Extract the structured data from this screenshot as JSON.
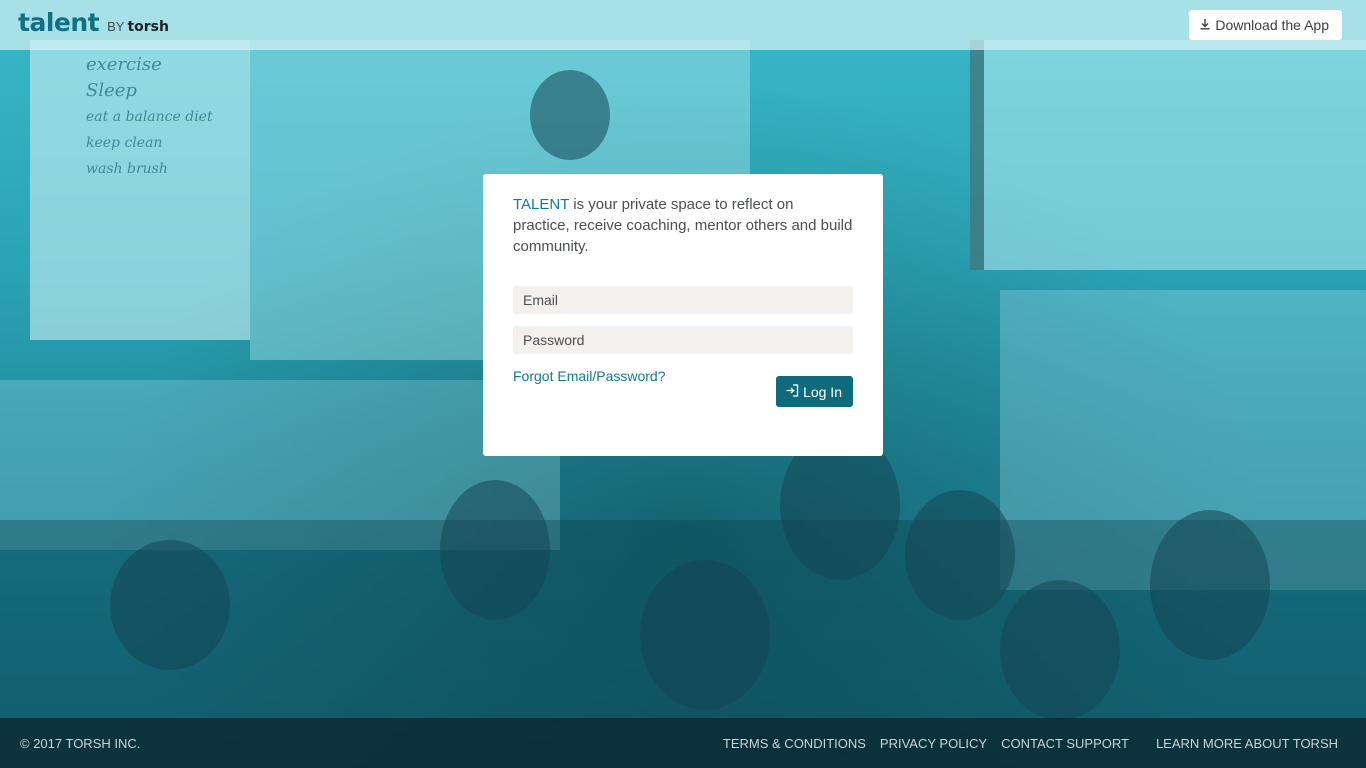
{
  "header": {
    "logo_main": "talent",
    "logo_by": "BY",
    "logo_company": "torsh",
    "download_label": "Download the App"
  },
  "login": {
    "intro_brand": "TALENT",
    "intro_text": " is your private space to reflect on practice, receive coaching, mentor others and build community.",
    "email_placeholder": "Email",
    "password_placeholder": "Password",
    "forgot_label": "Forgot Email/Password?",
    "login_label": "Log In"
  },
  "footer": {
    "copyright": "© 2017 TORSH INC.",
    "links": [
      "TERMS & CONDITIONS",
      "PRIVACY POLICY",
      "CONTACT SUPPORT",
      "LEARN MORE ABOUT TORSH"
    ]
  },
  "background": {
    "whiteboard_lines": [
      "exercise",
      "Sleep",
      "eat a balance diet",
      "keep clean",
      "wash brush"
    ]
  },
  "colors": {
    "brand": "#0f7183",
    "link": "#147a8c",
    "button": "#0f6b7c",
    "overlay": "#2aa3b5"
  },
  "icons": {
    "download": "download-icon",
    "login": "sign-in-icon"
  }
}
